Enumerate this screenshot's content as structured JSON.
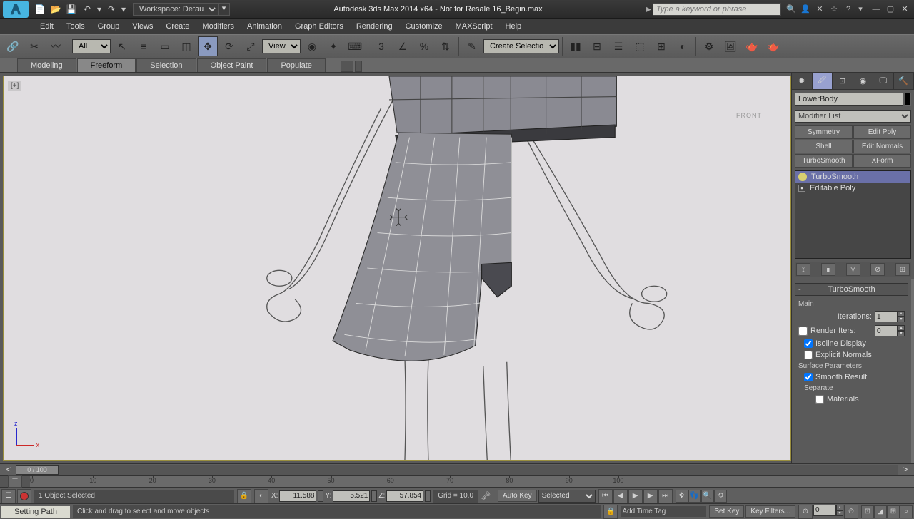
{
  "app": {
    "title": "Autodesk 3ds Max  2014 x64 - Not for Resale    16_Begin.max",
    "workspace": "Workspace: Default",
    "search_placeholder": "Type a keyword or phrase"
  },
  "menu": [
    "Edit",
    "Tools",
    "Group",
    "Views",
    "Create",
    "Modifiers",
    "Animation",
    "Graph Editors",
    "Rendering",
    "Customize",
    "MAXScript",
    "Help"
  ],
  "main_toolbar": {
    "sel_filter": "All",
    "coord_sys": "View",
    "named_sel": "Create Selection Se"
  },
  "ribbon": {
    "tabs": [
      "Modeling",
      "Freeform",
      "Selection",
      "Object Paint",
      "Populate"
    ],
    "active": 1
  },
  "viewport": {
    "corner_label": "[+]",
    "cube": "FRONT"
  },
  "cmd": {
    "object_name": "LowerBody",
    "modifier_list_label": "Modifier List",
    "mod_buttons": [
      "Symmetry",
      "Edit Poly",
      "Shell",
      "Edit Normals",
      "TurboSmooth",
      "XForm"
    ],
    "stack": [
      {
        "kind": "bulb",
        "label": "TurboSmooth",
        "selected": true
      },
      {
        "kind": "plus",
        "label": "Editable Poly",
        "selected": false
      }
    ],
    "rollout_title": "TurboSmooth",
    "main_label": "Main",
    "iterations_label": "Iterations:",
    "iterations_value": "1",
    "render_iters_label": "Render Iters:",
    "render_iters_value": "0",
    "isoline": "Isoline Display",
    "explicit_normals": "Explicit Normals",
    "surface_params": "Surface Parameters",
    "smooth_result": "Smooth Result",
    "separate": "Separate",
    "materials": "Materials"
  },
  "timeline": {
    "slider_label": "0 / 100",
    "ticks": [
      0,
      10,
      20,
      30,
      40,
      50,
      60,
      70,
      80,
      90,
      100
    ]
  },
  "status": {
    "selection": "1 Object Selected",
    "x": "11.588",
    "y": "5.521",
    "z": "57.854",
    "grid": "Grid = 10.0",
    "setting_path": "Setting Path",
    "prompt": "Click and drag to select and move objects",
    "time_tag": "Add Time Tag",
    "auto_key": "Auto Key",
    "set_key": "Set Key",
    "selected": "Selected",
    "key_filters": "Key Filters...",
    "frame": "0"
  }
}
